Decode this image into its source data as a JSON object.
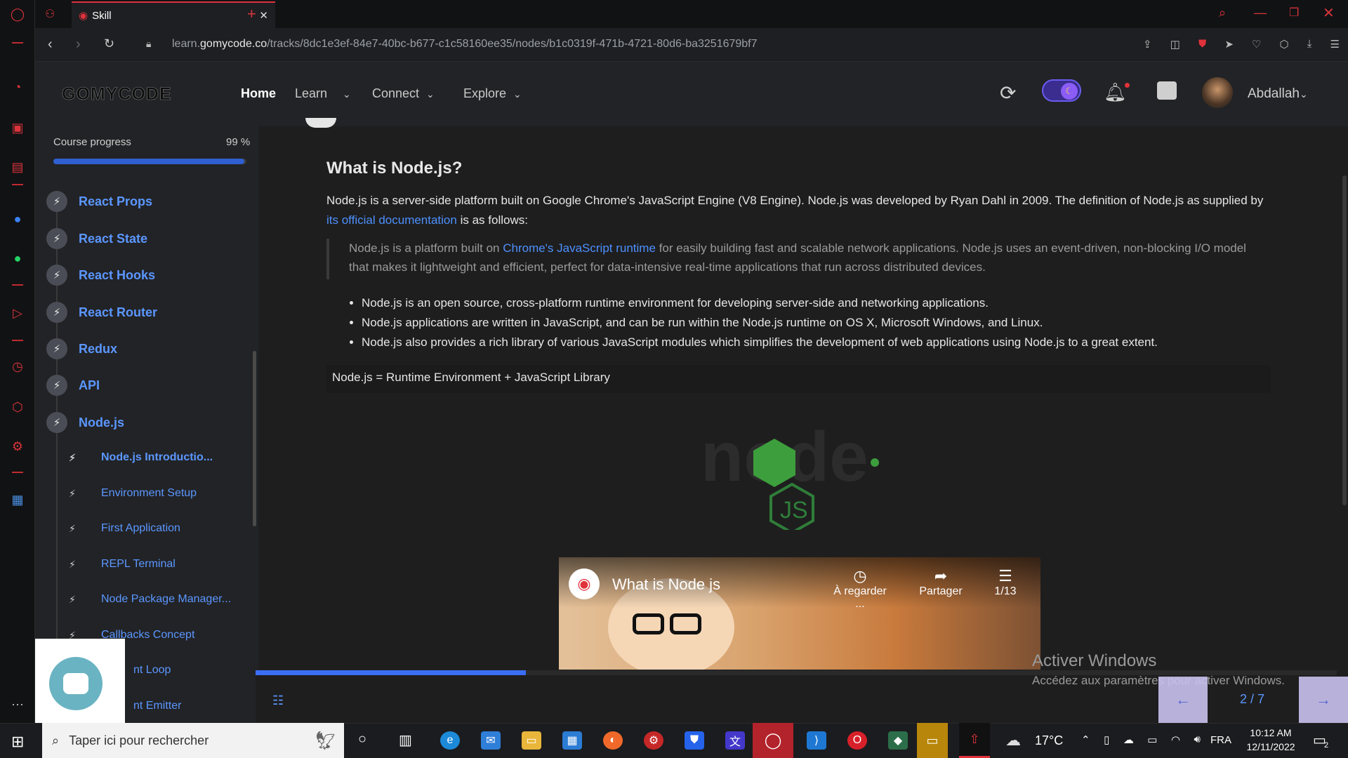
{
  "browser": {
    "tab_title": "Skill",
    "url_prefix": "learn.",
    "url_domain": "gomycode.co",
    "url_path": "/tracks/8dc1e3ef-84e7-40bc-b677-c1c58160ee35/nodes/b1c0319f-471b-4721-80d6-ba3251679bf7"
  },
  "header": {
    "logo": "GOMYCODE",
    "nav": [
      "Home",
      "Learn",
      "Connect",
      "Explore"
    ],
    "username": "Abdallah"
  },
  "sidebar": {
    "progress_label": "Course progress",
    "progress_value": "99 %",
    "progress_fraction": 0.99,
    "lessons": [
      "React Props",
      "React State",
      "React Hooks",
      "React Router",
      "Redux",
      "API",
      "Node.js"
    ],
    "subs": [
      "Node.js Introductio...",
      "Environment Setup",
      "First Application",
      "REPL Terminal",
      "Node Package Manager...",
      "Callbacks Concept",
      "nt Loop",
      "nt Emitter"
    ]
  },
  "content": {
    "title": "What is Node.js?",
    "p1_a": "Node.js is a server-side platform built on Google Chrome's JavaScript Engine (V8 Engine). Node.js was developed by Ryan Dahl in 2009. The definition of Node.js as supplied by ",
    "p1_link": "its official documentation",
    "p1_b": " is as follows:",
    "quote_a": "Node.js is a platform built on ",
    "quote_link": "Chrome's JavaScript runtime",
    "quote_b": " for easily building fast and scalable network applications. Node.js uses an event-driven, non-blocking I/O model that makes it lightweight and efficient, perfect for data-intensive real-time applications that run across distributed devices.",
    "bullets": [
      "Node.js is an open source, cross-platform runtime environment for developing server-side and networking applications.",
      "Node.js applications are written in JavaScript, and can be run within the Node.js runtime on OS X, Microsoft Windows, and Linux.",
      "Node.js also provides a rich library of various JavaScript modules which simplifies the development of web applications using Node.js to a great extent."
    ],
    "formula": "Node.js = Runtime Environment + JavaScript Library",
    "logo_text": "node",
    "logo_js": "JS"
  },
  "video": {
    "title": "What is Node js",
    "watch_later": "À regarder ...",
    "share": "Partager",
    "playlist": "1/13"
  },
  "bottom": {
    "progress_fraction": 0.25,
    "page": "2 / 7",
    "activate_title": "Activer Windows",
    "activate_sub": "Accédez aux paramètres pour activer Windows."
  },
  "taskbar": {
    "search_placeholder": "Taper ici pour rechercher",
    "weather": "17°C",
    "lang": "FRA",
    "time": "10:12 AM",
    "date": "12/11/2022",
    "notif_count": "2"
  }
}
